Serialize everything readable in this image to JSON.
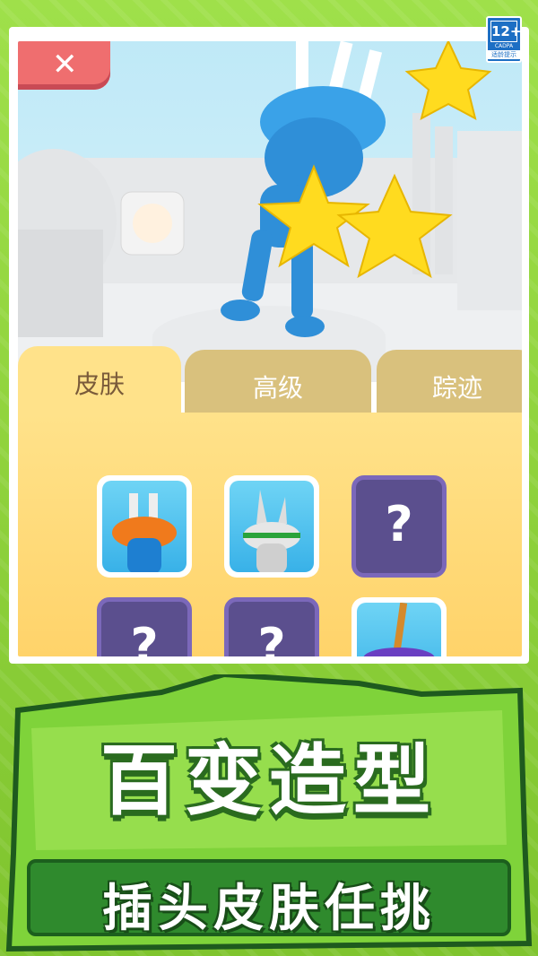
{
  "age_badge": {
    "age": "12+",
    "org": "CADPA",
    "tip": "适龄提示"
  },
  "close_button": {
    "icon": "close-icon",
    "glyph": "✕"
  },
  "tabs": [
    {
      "label": "皮肤",
      "active": true
    },
    {
      "label": "高级",
      "active": false
    },
    {
      "label": "踪迹",
      "active": false
    }
  ],
  "skins": [
    {
      "state": "unlocked",
      "icon": "orange-plug-skin-icon"
    },
    {
      "state": "unlocked",
      "icon": "green-plug-skin-icon"
    },
    {
      "state": "locked",
      "label": "?"
    },
    {
      "state": "locked",
      "label": "?"
    },
    {
      "state": "locked",
      "label": "?"
    },
    {
      "state": "unlocked",
      "icon": "purple-plug-skin-icon"
    }
  ],
  "banner": {
    "title": "百变造型",
    "subtitle": "插头皮肤任挑"
  },
  "colors": {
    "tab_active": "#ffe28a",
    "tab_inactive": "#d9c17d",
    "locked": "#5b4f8e",
    "brand_green": "#2f8a2d"
  }
}
